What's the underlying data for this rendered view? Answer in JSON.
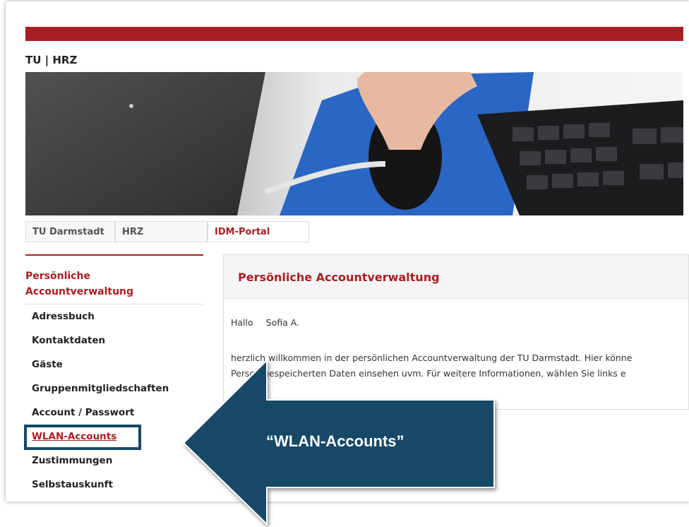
{
  "brand": "TU | HRZ",
  "tabs": [
    {
      "label": "TU Darmstadt"
    },
    {
      "label": "HRZ"
    },
    {
      "label": "IDM-Portal"
    }
  ],
  "sidebar": {
    "title_line1": "Persönliche",
    "title_line2": "Accountverwaltung",
    "items": [
      {
        "label": "Adressbuch"
      },
      {
        "label": "Kontaktdaten"
      },
      {
        "label": "Gäste"
      },
      {
        "label": "Gruppenmitgliedschaften"
      },
      {
        "label": "Account / Passwort"
      },
      {
        "label": "WLAN-Accounts"
      },
      {
        "label": "Zustimmungen"
      },
      {
        "label": "Selbstauskunft"
      }
    ]
  },
  "main": {
    "title": "Persönliche Accountverwaltung",
    "greeting": "Hallo",
    "user_name": "Sofia A.",
    "text_line1": "herzlich willkommen in der persönlichen Accountverwaltung der TU Darmstadt. Hier könne",
    "text_line2": "Person gespeicherten Daten einsehen uvm. Für weitere Informationen, wählen Sie links e"
  },
  "callout": {
    "label": "“WLAN-Accounts”"
  },
  "colors": {
    "brand_red": "#a81d22",
    "callout_blue": "#174866"
  }
}
